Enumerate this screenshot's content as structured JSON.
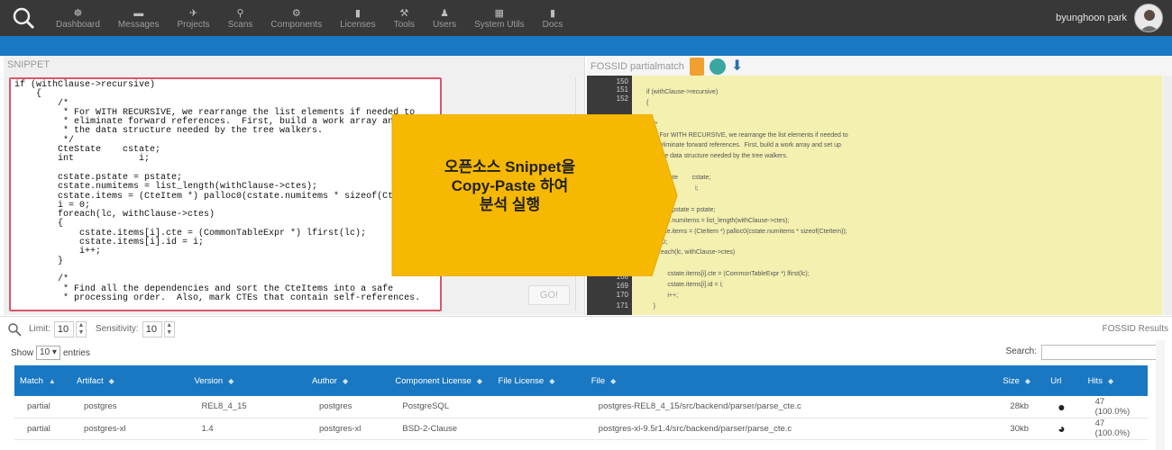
{
  "nav": {
    "items": [
      {
        "label": "Dashboard",
        "icon": "dashboard-icon",
        "glyph": "☸"
      },
      {
        "label": "Messages",
        "icon": "messages-icon",
        "glyph": "▬"
      },
      {
        "label": "Projects",
        "icon": "projects-icon",
        "glyph": "✈"
      },
      {
        "label": "Scans",
        "icon": "scans-icon",
        "glyph": "⚲"
      },
      {
        "label": "Components",
        "icon": "components-icon",
        "glyph": "⚙"
      },
      {
        "label": "Licenses",
        "icon": "licenses-icon",
        "glyph": "▮"
      },
      {
        "label": "Tools",
        "icon": "tools-icon",
        "glyph": "⚒"
      },
      {
        "label": "Users",
        "icon": "users-icon",
        "glyph": "♟"
      },
      {
        "label": "System Utils",
        "icon": "system-utils-icon",
        "glyph": "▦"
      },
      {
        "label": "Docs",
        "icon": "docs-icon",
        "glyph": "▮"
      }
    ],
    "user_name": "byunghoon park"
  },
  "snippet": {
    "title": "SNIPPET",
    "code": "if (withClause->recursive)\n    {\n        /*\n         * For WITH RECURSIVE, we rearrange the list elements if needed to\n         * eliminate forward references.  First, build a work array and set up\n         * the data structure needed by the tree walkers.\n         */\n        CteState    cstate;\n        int            i;\n\n        cstate.pstate = pstate;\n        cstate.numitems = list_length(withClause->ctes);\n        cstate.items = (CteItem *) palloc0(cstate.numitems * sizeof(CteItem));\n        i = 0;\n        foreach(lc, withClause->ctes)\n        {\n            cstate.items[i].cte = (CommonTableExpr *) lfirst(lc);\n            cstate.items[i].id = i;\n            i++;\n        }\n\n        /*\n         * Find all the dependencies and sort the CteItems into a safe\n         * processing order.  Also, mark CTEs that contain self-references.",
    "go_label": "GO!"
  },
  "fossid": {
    "title": "FOSSID partialmatch",
    "line_numbers": [
      "150",
      "151",
      "152",
      "",
      "",
      "",
      "",
      "",
      "",
      "",
      "",
      "",
      "",
      "",
      "",
      "",
      "",
      "",
      "168",
      "169",
      "170",
      "171"
    ],
    "lines": [
      "",
      "if (withClause->recursive)",
      "{",
      "",
      "    /*",
      "     * For WITH RECURSIVE, we rearrange the list elements if needed to",
      "     * eliminate forward references.  First, build a work array and set up",
      "     * the data structure needed by the tree walkers.",
      "     */",
      "    CteState        cstate;",
      "    int                    i;",
      "",
      "    cstate.pstate = pstate;",
      "    cstate.numitems = list_length(withClause->ctes);",
      "    cstate.items = (CteItem *) palloc0(cstate.numitems * sizeof(CteItem));",
      "    i = 0;",
      "    foreach(lc, withClause->ctes)",
      "    {",
      "            cstate.items[i].cte = (CommonTableExpr *) lfirst(lc);",
      "            cstate.items[i].id = i;",
      "            i++;",
      "    }"
    ]
  },
  "callout": {
    "line1": "오픈소스 Snippet을",
    "line2": "Copy-Paste 하여",
    "line3": "분석 실행"
  },
  "filters": {
    "limit_label": "Limit:",
    "limit_value": "10",
    "sensitivity_label": "Sensitivity:",
    "sensitivity_value": "10",
    "results_label": "FOSSID Results"
  },
  "table_controls": {
    "show_label": "Show",
    "entries_value": "10",
    "entries_label": "entries",
    "search_label": "Search:"
  },
  "table": {
    "headers": [
      "Match",
      "Artifact",
      "Version",
      "Author",
      "Component License",
      "File License",
      "File",
      "Size",
      "Url",
      "Hits"
    ],
    "rows": [
      {
        "match": "partial",
        "artifact": "postgres",
        "version": "REL8_4_15",
        "author": "postgres",
        "component_license": "PostgreSQL",
        "file_license": "",
        "file": "postgres-REL8_4_15/src/backend/parser/parse_cte.c",
        "size": "28kb",
        "url_icon": "github-icon",
        "hits": "47 (100.0%)"
      },
      {
        "match": "partial",
        "artifact": "postgres-xl",
        "version": "1.4",
        "author": "postgres-xl",
        "component_license": "BSD-2-Clause",
        "file_license": "",
        "file": "postgres-xl-9.5r1.4/src/backend/parser/parse_cte.c",
        "size": "30kb",
        "url_icon": "globe-icon",
        "hits": "47 (100.0%)"
      }
    ]
  }
}
